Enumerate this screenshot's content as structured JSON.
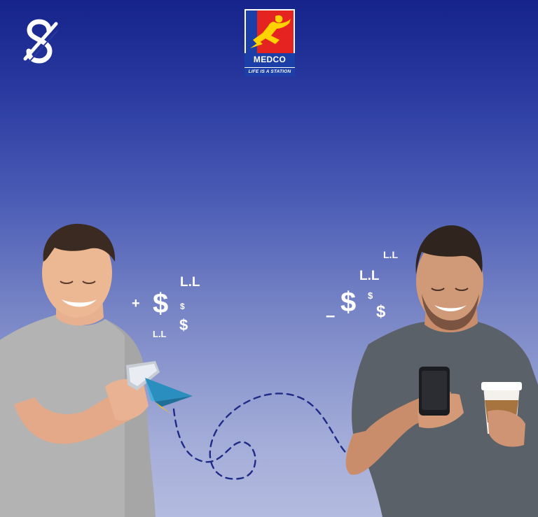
{
  "brand": {
    "name": "MEDCO",
    "slogan": "LIFE IS A STATION"
  },
  "left_symbols": {
    "plus": "+",
    "dollar_large": "$",
    "dollar_small": "$",
    "dollar_medium": "$",
    "ll_top": "L.L",
    "ll_bottom": "L.L"
  },
  "right_symbols": {
    "minus": "–",
    "dollar_large": "$",
    "dollar_small": "$",
    "dollar_medium": "$",
    "ll_top": "L.L",
    "ll_middle": "L.L"
  },
  "icons": {
    "app_logo": "slashed-s-logo-icon",
    "paper_plane": "paper-plane-icon"
  },
  "colors": {
    "background_top": "#15238a",
    "background_bottom": "#b4bbe0",
    "brand_red": "#e52421",
    "brand_blue": "#1b3fa6",
    "brand_yellow": "#ffd200",
    "path_dash": "#1f2b86",
    "plane_blue": "#2a8fbf",
    "plane_yellow": "#f3c21b"
  }
}
